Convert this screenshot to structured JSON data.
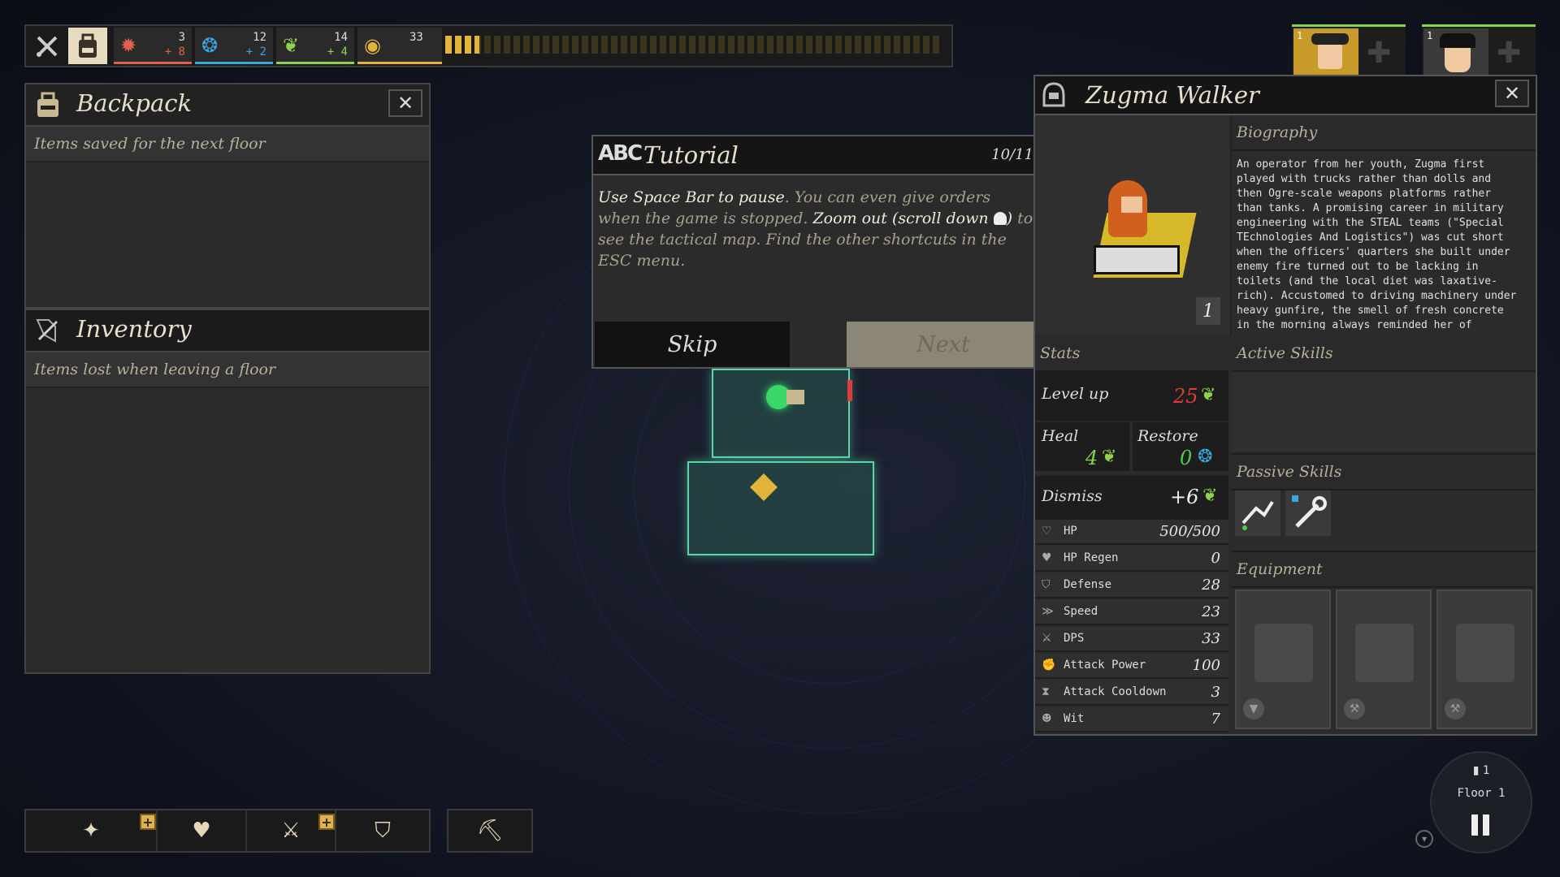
{
  "colors": {
    "gear_red": "#e0604a",
    "soul_blue": "#3aa8e0",
    "leaf_green": "#8fd14f",
    "gold": "#e2b43c",
    "level_red": "#e03a3a",
    "heal_green": "#7fd84a",
    "restore_green": "#4ed14a"
  },
  "topbar": {
    "tools_icon": "crossed-tools-icon",
    "backpack_icon": "backpack-icon",
    "resources": [
      {
        "icon": "gear-icon",
        "current": "3",
        "gain": "+ 8"
      },
      {
        "icon": "soul-icon",
        "current": "12",
        "gain": "+ 2"
      },
      {
        "icon": "leaf-icon",
        "current": "14",
        "gain": "+ 4"
      }
    ],
    "gold": {
      "icon": "coin-icon",
      "value": "33"
    }
  },
  "backpack": {
    "title": "Backpack",
    "subtitle": "Items saved for the next floor"
  },
  "inventory": {
    "title": "Inventory",
    "subtitle": "Items lost when leaving a floor"
  },
  "tutorial": {
    "title": "Tutorial",
    "progress": "10/11",
    "text_bold_1": "Use Space Bar to pause",
    "text_1": ". You can even give orders when the game is stopped. ",
    "text_bold_2": "Zoom out (scroll down ",
    "text_bold_3": ")",
    "text_2": " to see the tactical map. Find the other shortcuts in the ESC menu.",
    "skip_label": "Skip",
    "next_label": "Next"
  },
  "hero": {
    "name": "Zugma Walker",
    "level_badge": "1",
    "biography_title": "Biography",
    "biography": "An operator from her youth, Zugma first played with trucks rather than dolls and then Ogre-scale weapons platforms rather than tanks. A promising career in military engineering with the STEAL teams (\"Special TEchnologies And Logistics\") was cut short when the officers' quarters she built under enemy fire turned out to be lacking in toilets (and the local diet was laxative-rich). Accustomed to driving machinery under heavy gunfire, the smell of fresh concrete in the morning always reminded her of",
    "stats_title": "Stats",
    "active_skills_title": "Active Skills",
    "passive_skills_title": "Passive Skills",
    "equipment_title": "Equipment",
    "level_up": {
      "label": "Level up",
      "value": "25"
    },
    "heal": {
      "label": "Heal",
      "value": "4"
    },
    "restore": {
      "label": "Restore",
      "value": "0"
    },
    "dismiss": {
      "label": "Dismiss",
      "value": "+6"
    },
    "stats": [
      {
        "icon": "shield-outline-icon",
        "label": "HP",
        "value": "500/500"
      },
      {
        "icon": "heart-icon",
        "label": "HP Regen",
        "value": "0"
      },
      {
        "icon": "shield-icon",
        "label": "Defense",
        "value": "28"
      },
      {
        "icon": "speed-icon",
        "label": "Speed",
        "value": "23"
      },
      {
        "icon": "dps-icon",
        "label": "DPS",
        "value": "33"
      },
      {
        "icon": "fist-icon",
        "label": "Attack Power",
        "value": "100"
      },
      {
        "icon": "hourglass-icon",
        "label": "Attack Cooldown",
        "value": "3"
      },
      {
        "icon": "brain-icon",
        "label": "Wit",
        "value": "7"
      }
    ]
  },
  "party": [
    {
      "badge": "1"
    },
    {
      "badge": "1"
    }
  ],
  "floor": {
    "count": "1",
    "label": "Floor 1"
  }
}
